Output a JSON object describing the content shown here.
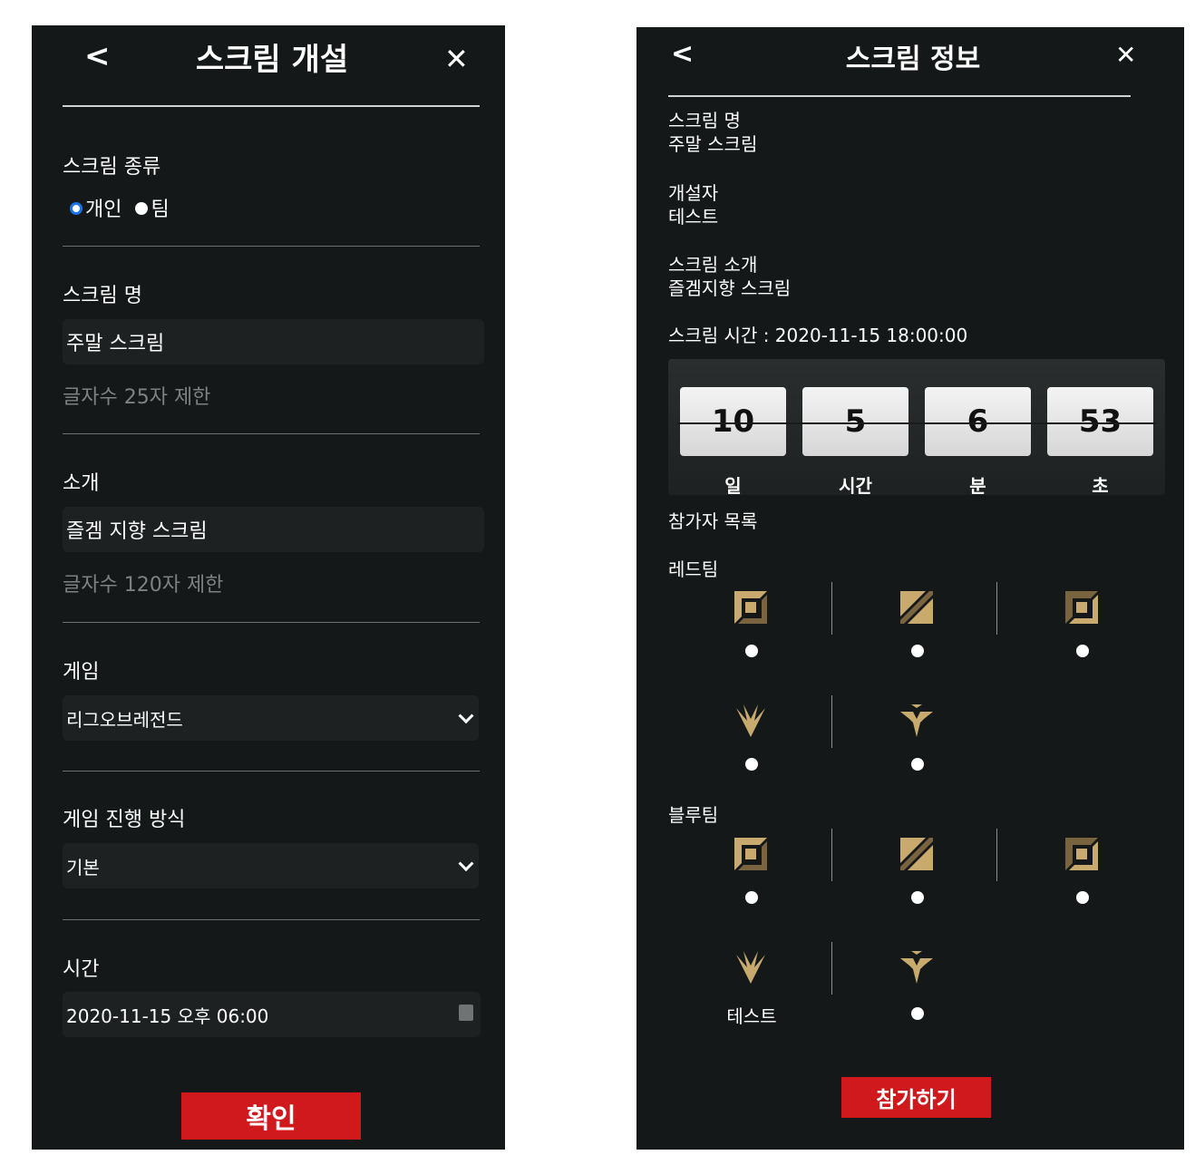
{
  "left": {
    "header": {
      "back": "<",
      "title": "스크림 개설",
      "close": "✕"
    },
    "type_section": {
      "label": "스크림 종류",
      "options": [
        "개인",
        "팀"
      ],
      "selected": "개인"
    },
    "name_section": {
      "label": "스크림 명",
      "value": "주말 스크림",
      "hint": "글자수 25자 제한"
    },
    "intro_section": {
      "label": "소개",
      "value": "즐겜 지향 스크림",
      "hint": "글자수 120자 제한"
    },
    "game_section": {
      "label": "게임",
      "value": "리그오브레전드"
    },
    "mode_section": {
      "label": "게임 진행 방식",
      "value": "기본"
    },
    "time_section": {
      "label": "시간",
      "value": "2020-11-15 오후 06:00"
    },
    "confirm_label": "확인"
  },
  "right": {
    "header": {
      "back": "<",
      "title": "스크림 정보",
      "close": "✕"
    },
    "name_label": "스크림 명",
    "name_value": "주말 스크림",
    "creator_label": "개설자",
    "creator_value": "테스트",
    "intro_label": "스크림 소개",
    "intro_value": "즐겜지향 스크림",
    "time_text": "스크림 시간 : 2020-11-15 18:00:00",
    "countdown": {
      "days": "10",
      "hours": "5",
      "minutes": "6",
      "seconds": "53",
      "days_label": "일",
      "hours_label": "시간",
      "minutes_label": "분",
      "seconds_label": "초"
    },
    "participants_label": "참가자 목록",
    "red_team_label": "레드팀",
    "blue_team_label": "블루팀",
    "blue_mid_player": "테스트",
    "position_icons": [
      "top-icon",
      "jungle-icon",
      "mid-icon",
      "adc-icon",
      "support-icon"
    ],
    "join_label": "참가하기"
  },
  "colors": {
    "background": "#141818",
    "accent_red": "#d0191c",
    "icon_gold": "#c8aa6e",
    "radio_selected": "#1a73e8"
  }
}
